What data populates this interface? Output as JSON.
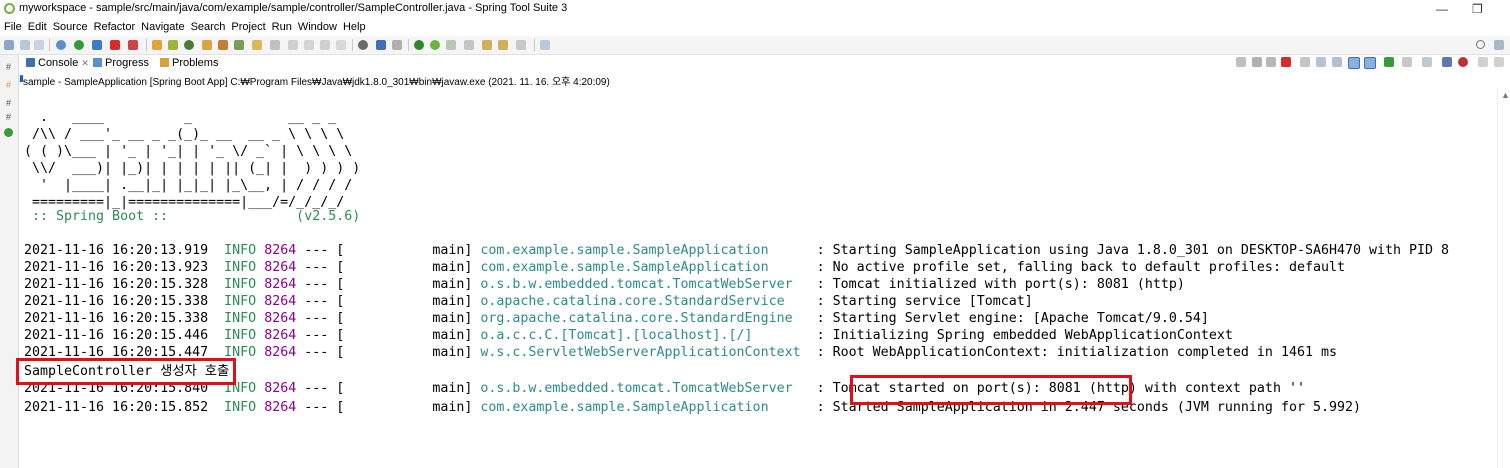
{
  "window": {
    "title": "myworkspace - sample/src/main/java/com/example/sample/controller/SampleController.java - Spring Tool Suite 3",
    "minimize": "—",
    "restore": "❐"
  },
  "menu": [
    "File",
    "Edit",
    "Source",
    "Refactor",
    "Navigate",
    "Search",
    "Project",
    "Run",
    "Window",
    "Help"
  ],
  "view_tabs": {
    "console": "Console",
    "console_close": "✕",
    "progress": "Progress",
    "problems": "Problems"
  },
  "launch_path": "sample - SampleApplication [Spring Boot App] C:₩Program Files₩Java₩jdk1.8.0_301₩bin₩javaw.exe  (2021. 11. 16. 오후 4:20:09)",
  "console": {
    "banner": [
      "  .   ____          _            __ _ _",
      " /\\\\ / ___'_ __ _ _(_)_ __  __ _ \\ \\ \\ \\",
      "( ( )\\___ | '_ | '_| | '_ \\/ _` | \\ \\ \\ \\",
      " \\\\/  ___)| |_)| | | | | || (_| |  ) ) ) )",
      "  '  |____| .__|_| |_|_| |_\\__, | / / / /",
      " =========|_|==============|___/=/_/_/_/"
    ],
    "boot_line": " :: Spring Boot ::                (v2.5.6)",
    "logs": [
      {
        "ts": "2021-11-16 16:20:13.919",
        "level": "INFO",
        "pid": "8264",
        "thread": "main",
        "logger": "com.example.sample.SampleApplication     ",
        "msg": "Starting SampleApplication using Java 1.8.0_301 on DESKTOP-SA6H470 with PID 8"
      },
      {
        "ts": "2021-11-16 16:20:13.923",
        "level": "INFO",
        "pid": "8264",
        "thread": "main",
        "logger": "com.example.sample.SampleApplication     ",
        "msg": "No active profile set, falling back to default profiles: default"
      },
      {
        "ts": "2021-11-16 16:20:15.328",
        "level": "INFO",
        "pid": "8264",
        "thread": "main",
        "logger": "o.s.b.w.embedded.tomcat.TomcatWebServer  ",
        "msg": "Tomcat initialized with port(s): 8081 (http)"
      },
      {
        "ts": "2021-11-16 16:20:15.338",
        "level": "INFO",
        "pid": "8264",
        "thread": "main",
        "logger": "o.apache.catalina.core.StandardService   ",
        "msg": "Starting service [Tomcat]"
      },
      {
        "ts": "2021-11-16 16:20:15.338",
        "level": "INFO",
        "pid": "8264",
        "thread": "main",
        "logger": "org.apache.catalina.core.StandardEngine  ",
        "msg": "Starting Servlet engine: [Apache Tomcat/9.0.54]"
      },
      {
        "ts": "2021-11-16 16:20:15.446",
        "level": "INFO",
        "pid": "8264",
        "thread": "main",
        "logger": "o.a.c.c.C.[Tomcat].[localhost].[/]       ",
        "msg": "Initializing Spring embedded WebApplicationContext"
      },
      {
        "ts": "2021-11-16 16:20:15.447",
        "level": "INFO",
        "pid": "8264",
        "thread": "main",
        "logger": "w.s.c.ServletWebServerApplicationContext ",
        "msg": "Root WebApplicationContext: initialization completed in 1461 ms"
      }
    ],
    "stdout_line": "SampleController 생성자 호출",
    "logs_after": [
      {
        "ts": "2021-11-16 16:20:15.840",
        "level": "INFO",
        "pid": "8264",
        "thread": "main",
        "logger": "o.s.b.w.embedded.tomcat.TomcatWebServer  ",
        "msg": "Tomcat started on port(s): 8081 (http) with context path ''"
      },
      {
        "ts": "2021-11-16 16:20:15.852",
        "level": "INFO",
        "pid": "8264",
        "thread": "main",
        "logger": "com.example.sample.SampleApplication     ",
        "msg": "Started SampleApplication in 2.447 seconds (JVM running for 5.992)"
      }
    ]
  },
  "colors": {
    "highlight_box": "#e0101a",
    "info_level": "#2e8b57",
    "pid": "#8b008b",
    "logger": "#2e8b8b"
  }
}
